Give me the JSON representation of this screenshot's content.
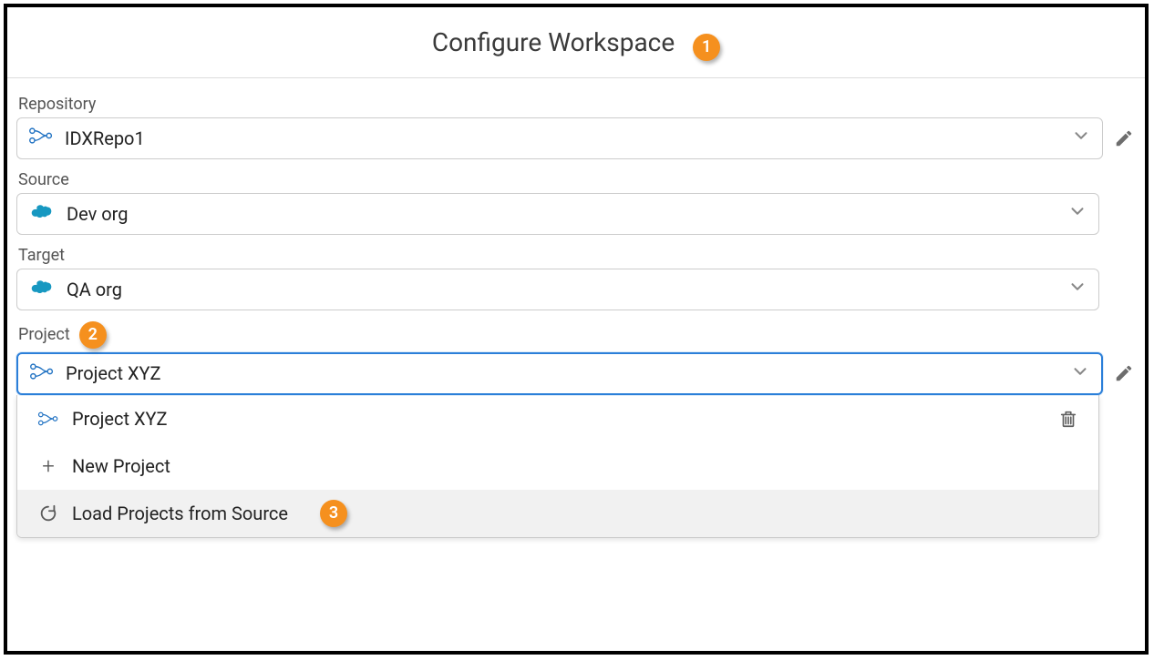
{
  "header": {
    "title": "Configure Workspace"
  },
  "callouts": {
    "c1": "1",
    "c2": "2",
    "c3": "3"
  },
  "fields": {
    "repository": {
      "label": "Repository",
      "value": "IDXRepo1"
    },
    "source": {
      "label": "Source",
      "value": "Dev org"
    },
    "target": {
      "label": "Target",
      "value": "QA org"
    },
    "project": {
      "label": "Project",
      "value": "Project XYZ"
    }
  },
  "project_options": {
    "existing": "Project XYZ",
    "new": "New Project",
    "load": "Load Projects from Source"
  }
}
